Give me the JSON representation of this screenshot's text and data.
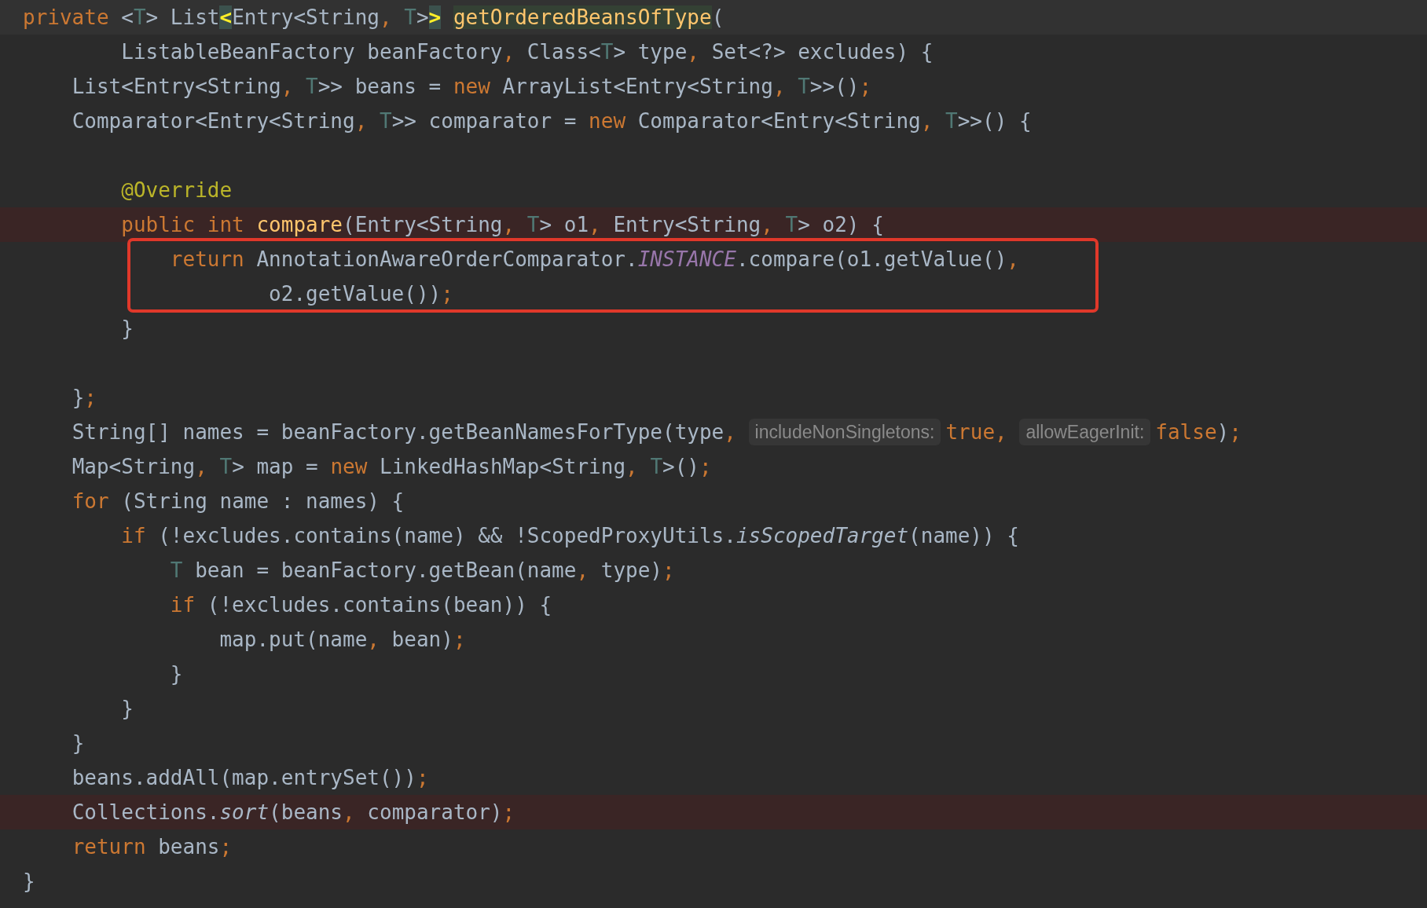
{
  "editor": {
    "lines": [
      {
        "kind": "code",
        "caret_line": true,
        "tokens": [
          {
            "kind": "kw",
            "text": "private"
          },
          {
            "kind": "plain",
            "text": " <"
          },
          {
            "kind": "tp",
            "text": "T"
          },
          {
            "kind": "plain",
            "text": "> List"
          },
          {
            "kind": "match",
            "text": "<"
          },
          {
            "kind": "plain",
            "text": "Entry<String"
          },
          {
            "kind": "punct",
            "text": ", "
          },
          {
            "kind": "tp",
            "text": "T"
          },
          {
            "kind": "plain",
            "text": ">"
          },
          {
            "kind": "match",
            "text": ">"
          },
          {
            "kind": "decl_hl",
            "text": " getOrderedBeansOfType"
          },
          {
            "kind": "plain",
            "text": "("
          }
        ]
      },
      {
        "kind": "code",
        "tokens": [
          {
            "kind": "plain",
            "text": "        ListableBeanFactory beanFactory"
          },
          {
            "kind": "punct",
            "text": ","
          },
          {
            "kind": "plain",
            "text": " Class<"
          },
          {
            "kind": "tp",
            "text": "T"
          },
          {
            "kind": "plain",
            "text": "> type"
          },
          {
            "kind": "punct",
            "text": ","
          },
          {
            "kind": "plain",
            "text": " Set<?> excludes) {"
          }
        ]
      },
      {
        "kind": "code",
        "tokens": [
          {
            "kind": "plain",
            "text": "    List<Entry<String"
          },
          {
            "kind": "punct",
            "text": ", "
          },
          {
            "kind": "tp",
            "text": "T"
          },
          {
            "kind": "plain",
            "text": ">> beans = "
          },
          {
            "kind": "kw",
            "text": "new"
          },
          {
            "kind": "plain",
            "text": " ArrayList<Entry<String"
          },
          {
            "kind": "punct",
            "text": ", "
          },
          {
            "kind": "tp",
            "text": "T"
          },
          {
            "kind": "plain",
            "text": ">>()"
          },
          {
            "kind": "punct",
            "text": ";"
          }
        ]
      },
      {
        "kind": "code",
        "tokens": [
          {
            "kind": "plain",
            "text": "    Comparator<Entry<String"
          },
          {
            "kind": "punct",
            "text": ", "
          },
          {
            "kind": "tp",
            "text": "T"
          },
          {
            "kind": "plain",
            "text": ">> comparator = "
          },
          {
            "kind": "kw",
            "text": "new"
          },
          {
            "kind": "plain",
            "text": " Comparator<Entry<String"
          },
          {
            "kind": "punct",
            "text": ", "
          },
          {
            "kind": "tp",
            "text": "T"
          },
          {
            "kind": "plain",
            "text": ">>() {"
          }
        ]
      },
      {
        "kind": "blank"
      },
      {
        "kind": "code",
        "tokens": [
          {
            "kind": "ann",
            "text": "        @Override"
          }
        ]
      },
      {
        "kind": "code",
        "error_highlight": true,
        "tokens": [
          {
            "kind": "kw",
            "text": "        public int"
          },
          {
            "kind": "decl",
            "text": " compare"
          },
          {
            "kind": "plain",
            "text": "(Entry<String"
          },
          {
            "kind": "punct",
            "text": ", "
          },
          {
            "kind": "tp",
            "text": "T"
          },
          {
            "kind": "plain",
            "text": "> o1"
          },
          {
            "kind": "punct",
            "text": ","
          },
          {
            "kind": "plain",
            "text": " Entry<String"
          },
          {
            "kind": "punct",
            "text": ", "
          },
          {
            "kind": "tp",
            "text": "T"
          },
          {
            "kind": "plain",
            "text": "> o2) {"
          }
        ]
      },
      {
        "kind": "code",
        "boxed": true,
        "tokens": [
          {
            "kind": "kw",
            "text": "            return"
          },
          {
            "kind": "plain",
            "text": " AnnotationAwareOrderComparator."
          },
          {
            "kind": "static",
            "text": "INSTANCE"
          },
          {
            "kind": "plain",
            "text": ".compare(o1.getValue()"
          },
          {
            "kind": "punct",
            "text": ","
          }
        ]
      },
      {
        "kind": "code",
        "boxed": true,
        "tokens": [
          {
            "kind": "plain",
            "text": "                    o2.getValue())"
          },
          {
            "kind": "punct",
            "text": ";"
          }
        ]
      },
      {
        "kind": "code",
        "tokens": [
          {
            "kind": "plain",
            "text": "        }"
          }
        ]
      },
      {
        "kind": "blank"
      },
      {
        "kind": "code",
        "tokens": [
          {
            "kind": "plain",
            "text": "    }"
          },
          {
            "kind": "punct",
            "text": ";"
          }
        ]
      },
      {
        "kind": "code",
        "tokens": [
          {
            "kind": "plain",
            "text": "    String[] names = beanFactory.getBeanNamesForType(type"
          },
          {
            "kind": "punct",
            "text": ", "
          },
          {
            "kind": "hint",
            "text": "includeNonSingletons:"
          },
          {
            "kind": "kw",
            "text": "true"
          },
          {
            "kind": "punct",
            "text": ", "
          },
          {
            "kind": "hint",
            "text": "allowEagerInit:"
          },
          {
            "kind": "kw",
            "text": "false"
          },
          {
            "kind": "plain",
            "text": ")"
          },
          {
            "kind": "punct",
            "text": ";"
          }
        ]
      },
      {
        "kind": "code",
        "tokens": [
          {
            "kind": "plain",
            "text": "    Map<String"
          },
          {
            "kind": "punct",
            "text": ", "
          },
          {
            "kind": "tp",
            "text": "T"
          },
          {
            "kind": "plain",
            "text": "> map = "
          },
          {
            "kind": "kw",
            "text": "new"
          },
          {
            "kind": "plain",
            "text": " LinkedHashMap<String"
          },
          {
            "kind": "punct",
            "text": ", "
          },
          {
            "kind": "tp",
            "text": "T"
          },
          {
            "kind": "plain",
            "text": ">()"
          },
          {
            "kind": "punct",
            "text": ";"
          }
        ]
      },
      {
        "kind": "code",
        "tokens": [
          {
            "kind": "kw",
            "text": "    for"
          },
          {
            "kind": "plain",
            "text": " (String name : names) {"
          }
        ]
      },
      {
        "kind": "code",
        "tokens": [
          {
            "kind": "kw",
            "text": "        if"
          },
          {
            "kind": "plain",
            "text": " (!excludes.contains(name) && !ScopedProxyUtils."
          },
          {
            "kind": "italic",
            "text": "isScopedTarget"
          },
          {
            "kind": "plain",
            "text": "(name)) {"
          }
        ]
      },
      {
        "kind": "code",
        "tokens": [
          {
            "kind": "tp",
            "text": "            T"
          },
          {
            "kind": "plain",
            "text": " bean = beanFactory.getBean(name"
          },
          {
            "kind": "punct",
            "text": ","
          },
          {
            "kind": "plain",
            "text": " type)"
          },
          {
            "kind": "punct",
            "text": ";"
          }
        ]
      },
      {
        "kind": "code",
        "tokens": [
          {
            "kind": "kw",
            "text": "            if"
          },
          {
            "kind": "plain",
            "text": " (!excludes.contains(bean)) {"
          }
        ]
      },
      {
        "kind": "code",
        "tokens": [
          {
            "kind": "plain",
            "text": "                map.put(name"
          },
          {
            "kind": "punct",
            "text": ","
          },
          {
            "kind": "plain",
            "text": " bean)"
          },
          {
            "kind": "punct",
            "text": ";"
          }
        ]
      },
      {
        "kind": "code",
        "tokens": [
          {
            "kind": "plain",
            "text": "            }"
          }
        ]
      },
      {
        "kind": "code",
        "tokens": [
          {
            "kind": "plain",
            "text": "        }"
          }
        ]
      },
      {
        "kind": "code",
        "tokens": [
          {
            "kind": "plain",
            "text": "    }"
          }
        ]
      },
      {
        "kind": "code",
        "tokens": [
          {
            "kind": "plain",
            "text": "    beans.addAll(map.entrySet())"
          },
          {
            "kind": "punct",
            "text": ";"
          }
        ]
      },
      {
        "kind": "code",
        "error_highlight": true,
        "tokens": [
          {
            "kind": "plain",
            "text": "    Collections."
          },
          {
            "kind": "italic",
            "text": "sort"
          },
          {
            "kind": "plain",
            "text": "(beans"
          },
          {
            "kind": "punct",
            "text": ","
          },
          {
            "kind": "plain",
            "text": " comparator)"
          },
          {
            "kind": "punct",
            "text": ";"
          }
        ]
      },
      {
        "kind": "code",
        "tokens": [
          {
            "kind": "kw",
            "text": "    return"
          },
          {
            "kind": "plain",
            "text": " beans"
          },
          {
            "kind": "punct",
            "text": ";"
          }
        ]
      },
      {
        "kind": "code",
        "tokens": [
          {
            "kind": "plain",
            "text": "}"
          }
        ]
      }
    ]
  }
}
